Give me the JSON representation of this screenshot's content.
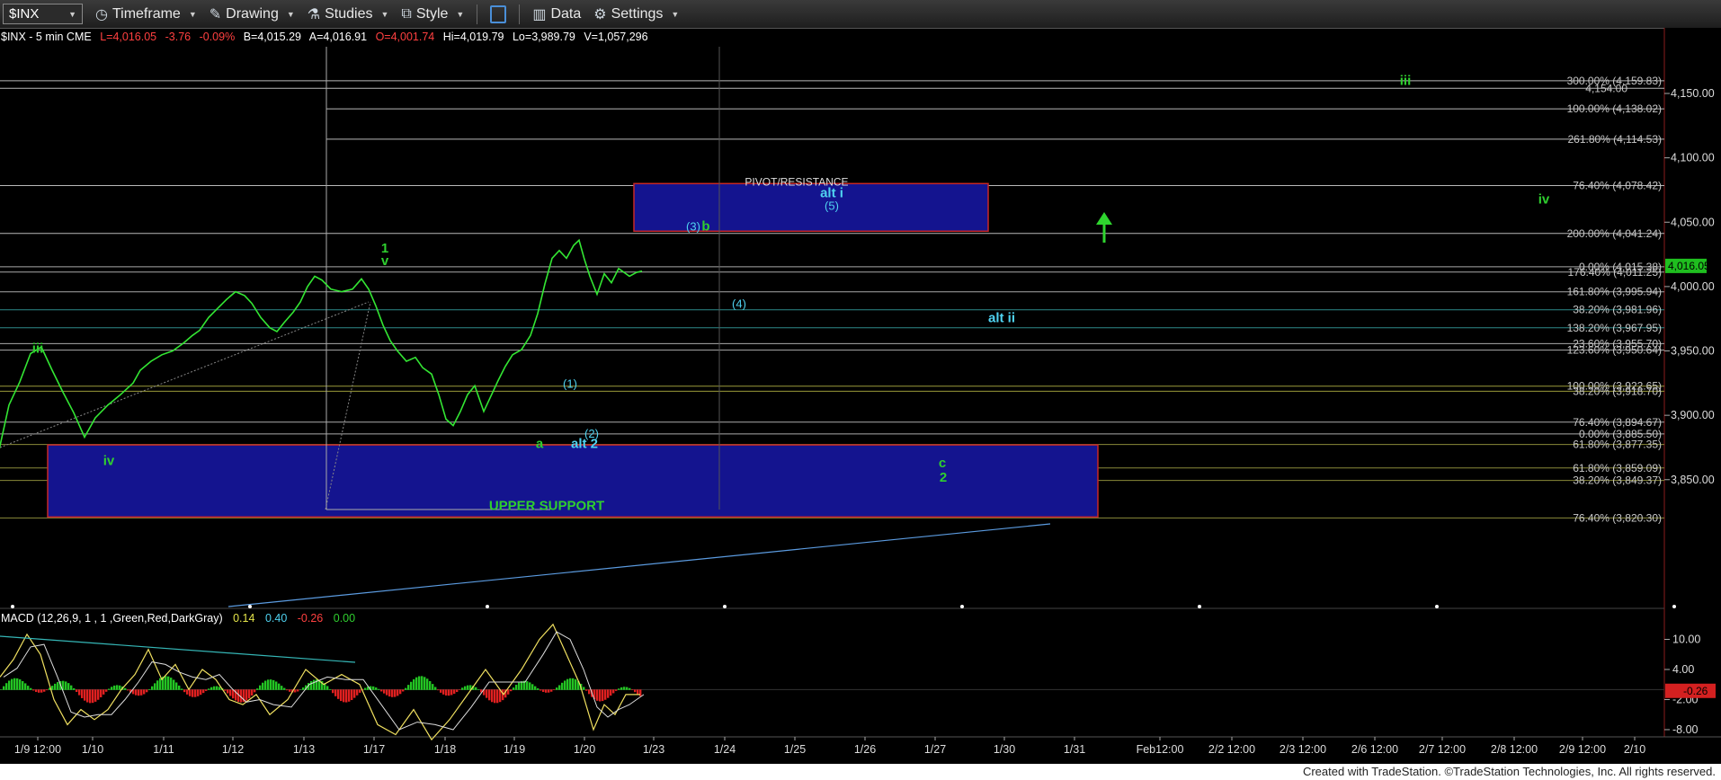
{
  "toolbar": {
    "symbol": "$INX",
    "items": [
      {
        "label": "Timeframe",
        "icon": "clock-icon"
      },
      {
        "label": "Drawing",
        "icon": "pencil-icon"
      },
      {
        "label": "Studies",
        "icon": "flask-icon"
      },
      {
        "label": "Style",
        "icon": "style-icon"
      },
      {
        "label": "Data",
        "icon": "bar-chart-icon"
      },
      {
        "label": "Settings",
        "icon": "gear-icon"
      }
    ]
  },
  "header": {
    "symbol": "$INX - 5 min  CME",
    "last": "L=4,016.05",
    "change": "-3.76",
    "pct": "-0.09%",
    "bid": "B=4,015.29",
    "ask": "A=4,016.91",
    "open": "O=4,001.74",
    "hi": "Hi=4,019.79",
    "lo": "Lo=3,989.79",
    "volume": "V=1,057,296"
  },
  "macd_header": {
    "label": "MACD (12,26,9, 1 , 1 ,Green,Red,DarkGray)",
    "v1": "0.14",
    "v2": "0.40",
    "v3": "-0.26",
    "v4": "0.00"
  },
  "footer": "Created with TradeStation. ©TradeStation Technologies, Inc. All rights reserved.",
  "colors": {
    "price": "#33e633",
    "wave_green": "#2fcf2f",
    "wave_cyan": "#4fd2f0",
    "box": "#1a1aa0",
    "box_border": "#d02a2a",
    "last_badge": "#1fbe1f"
  },
  "chart_data": {
    "type": "line",
    "ylim": [
      3820,
      4180
    ],
    "yticks": [
      "4,150.00",
      "4,100.00",
      "4,050.00",
      "4,000.00",
      "3,950.00",
      "3,900.00",
      "3,850.00"
    ],
    "ytick_values": [
      4150,
      4100,
      4050,
      4000,
      3950,
      3900,
      3850
    ],
    "last_price_badge": "4,016.05",
    "last_price": 4016.05,
    "xticks": [
      "1/9 12:00",
      "1/10",
      "1/11",
      "1/12",
      "1/13",
      "1/17",
      "1/18",
      "1/19",
      "1/20",
      "1/23",
      "1/24",
      "1/25",
      "1/26",
      "1/27",
      "1/30",
      "1/31",
      "Feb12:00",
      "2/2 12:00",
      "2/3 12:00",
      "2/6 12:00",
      "2/7 12:00",
      "2/8 12:00",
      "2/9 12:00",
      "2/10"
    ],
    "price_path": [
      [
        -2,
        3870
      ],
      [
        10,
        3908
      ],
      [
        22,
        3926
      ],
      [
        34,
        3948
      ],
      [
        46,
        3953
      ],
      [
        58,
        3935
      ],
      [
        70,
        3918
      ],
      [
        82,
        3902
      ],
      [
        94,
        3883
      ],
      [
        106,
        3898
      ],
      [
        120,
        3908
      ],
      [
        134,
        3916
      ],
      [
        148,
        3925
      ],
      [
        156,
        3935
      ],
      [
        168,
        3942
      ],
      [
        180,
        3947
      ],
      [
        192,
        3950
      ],
      [
        204,
        3956
      ],
      [
        214,
        3962
      ],
      [
        222,
        3966
      ],
      [
        232,
        3976
      ],
      [
        242,
        3983
      ],
      [
        252,
        3990
      ],
      [
        262,
        3996
      ],
      [
        272,
        3993
      ],
      [
        280,
        3987
      ],
      [
        290,
        3976
      ],
      [
        300,
        3968
      ],
      [
        308,
        3965
      ],
      [
        316,
        3972
      ],
      [
        326,
        3980
      ],
      [
        334,
        3988
      ],
      [
        342,
        4000
      ],
      [
        350,
        4008
      ],
      [
        358,
        4005
      ],
      [
        368,
        3998
      ],
      [
        380,
        3996
      ],
      [
        392,
        3998
      ],
      [
        402,
        4006
      ],
      [
        410,
        3998
      ],
      [
        418,
        3985
      ],
      [
        426,
        3970
      ],
      [
        434,
        3958
      ],
      [
        442,
        3950
      ],
      [
        452,
        3942
      ],
      [
        462,
        3945
      ],
      [
        470,
        3937
      ],
      [
        480,
        3932
      ],
      [
        488,
        3916
      ],
      [
        496,
        3897
      ],
      [
        504,
        3892
      ],
      [
        512,
        3903
      ],
      [
        520,
        3916
      ],
      [
        528,
        3923
      ],
      [
        538,
        3903
      ],
      [
        546,
        3915
      ],
      [
        554,
        3927
      ],
      [
        562,
        3938
      ],
      [
        570,
        3947
      ],
      [
        580,
        3951
      ],
      [
        590,
        3962
      ],
      [
        598,
        3979
      ],
      [
        606,
        4002
      ],
      [
        614,
        4022
      ],
      [
        622,
        4028
      ],
      [
        630,
        4022
      ],
      [
        638,
        4032
      ],
      [
        644,
        4036
      ],
      [
        650,
        4021
      ],
      [
        656,
        4008
      ],
      [
        664,
        3994
      ],
      [
        672,
        4010
      ],
      [
        680,
        4003
      ],
      [
        688,
        4014
      ],
      [
        694,
        4011
      ],
      [
        700,
        4008
      ],
      [
        708,
        4011
      ],
      [
        714,
        4012
      ]
    ],
    "macd_path": [
      [
        0,
        2.5
      ],
      [
        15,
        6
      ],
      [
        30,
        11
      ],
      [
        45,
        7
      ],
      [
        60,
        -2
      ],
      [
        75,
        -7
      ],
      [
        90,
        -4
      ],
      [
        105,
        -6
      ],
      [
        120,
        -4
      ],
      [
        135,
        0
      ],
      [
        150,
        3
      ],
      [
        165,
        8
      ],
      [
        180,
        2
      ],
      [
        195,
        5
      ],
      [
        210,
        0
      ],
      [
        225,
        4
      ],
      [
        240,
        2
      ],
      [
        255,
        -2
      ],
      [
        270,
        -3
      ],
      [
        285,
        -1
      ],
      [
        300,
        -5
      ],
      [
        320,
        -2
      ],
      [
        340,
        4
      ],
      [
        360,
        1
      ],
      [
        380,
        3
      ],
      [
        400,
        1
      ],
      [
        420,
        -7
      ],
      [
        440,
        -9
      ],
      [
        460,
        -4
      ],
      [
        480,
        -10
      ],
      [
        500,
        -6
      ],
      [
        520,
        -1
      ],
      [
        540,
        4
      ],
      [
        560,
        -1
      ],
      [
        580,
        4
      ],
      [
        600,
        10
      ],
      [
        615,
        13
      ],
      [
        630,
        7
      ],
      [
        645,
        1
      ],
      [
        660,
        -8
      ],
      [
        672,
        -3
      ],
      [
        684,
        -5
      ],
      [
        696,
        -1
      ],
      [
        712,
        -1
      ]
    ],
    "macd_yticks": [
      "10.00",
      "4.00",
      "-2.00",
      "-8.00"
    ],
    "macd_ytick_values": [
      10,
      4,
      -2,
      -8
    ],
    "macd_last": "-0.26",
    "fib_levels": [
      {
        "label": "300.00% (4,159.83)",
        "value": 4159.83
      },
      {
        "label": "4,154.00",
        "value": 4154
      },
      {
        "label": "100.00% (4,138.02)",
        "value": 4138.02
      },
      {
        "label": "261.80% (4,114.53)",
        "value": 4114.53
      },
      {
        "label": "76.40% (4,078.42)",
        "value": 4078.42
      },
      {
        "label": "200.00% (4,041.24)",
        "value": 4041.24
      },
      {
        "label": "0.00% (4,015.38)",
        "value": 4015.38
      },
      {
        "label": "176.40% (4,011.25)",
        "value": 4011.25
      },
      {
        "label": "161.80% (3,995.94)",
        "value": 3995.94
      },
      {
        "label": "38.20% (3,981.96)",
        "value": 3981.96
      },
      {
        "label": "138.20% (3,967.95)",
        "value": 3967.95
      },
      {
        "label": "23.60% (3,955.70)",
        "value": 3955.7
      },
      {
        "label": "123.60% (3,950.64)",
        "value": 3950.64
      },
      {
        "label": "100.00% (3,922.65)",
        "value": 3922.65
      },
      {
        "label": "38.20% (3,918.70)",
        "value": 3918.7
      },
      {
        "label": "76.40% (3,894.67)",
        "value": 3894.67
      },
      {
        "label": "0.00% (3,885.50)",
        "value": 3885.5
      },
      {
        "label": "61.80% (3,877.35)",
        "value": 3877.35
      },
      {
        "label": "61.80% (3,859.09)",
        "value": 3859.09
      },
      {
        "label": "38.20% (3,849.37)",
        "value": 3849.37
      },
      {
        "label": "76.40% (3,820.30)",
        "value": 3820.3
      }
    ],
    "annotations": [
      {
        "text": "iii",
        "color": "green",
        "value": 3952
      },
      {
        "text": "iv",
        "color": "green",
        "value": 3865
      },
      {
        "text": "1",
        "color": "green",
        "value": 4030
      },
      {
        "text": "v",
        "color": "green",
        "value": 4020
      },
      {
        "text": "a",
        "color": "green",
        "value": 3878
      },
      {
        "text": "alt 2",
        "color": "cyan",
        "value": 3878
      },
      {
        "text": "(1)",
        "color": "cyan",
        "value": 3925
      },
      {
        "text": "(2)",
        "color": "cyan",
        "value": 3886
      },
      {
        "text": "(3)",
        "color": "cyan",
        "value": 4047
      },
      {
        "text": "b",
        "color": "green",
        "value": 4047
      },
      {
        "text": "(4)",
        "color": "cyan",
        "value": 3987
      },
      {
        "text": "alt i",
        "color": "cyan",
        "value": 4073
      },
      {
        "text": "(5)",
        "color": "cyan",
        "value": 4063
      },
      {
        "text": "PIVOT/RESISTANCE",
        "color": "white",
        "value": 4082
      },
      {
        "text": "alt ii",
        "color": "cyan",
        "value": 3976
      },
      {
        "text": "iii",
        "color": "green",
        "value": 4160
      },
      {
        "text": "iv",
        "color": "green",
        "value": 4068
      },
      {
        "text": "c",
        "color": "green",
        "value": 3863
      },
      {
        "text": "2",
        "color": "green",
        "value": 3852
      },
      {
        "text": "UPPER SUPPORT",
        "color": "green",
        "value": 3830
      }
    ],
    "zones": [
      {
        "name": "PIVOT/RESISTANCE",
        "y_top": 4080,
        "y_bottom": 4043
      },
      {
        "name": "UPPER SUPPORT",
        "y_top": 3877,
        "y_bottom": 3821
      }
    ]
  }
}
